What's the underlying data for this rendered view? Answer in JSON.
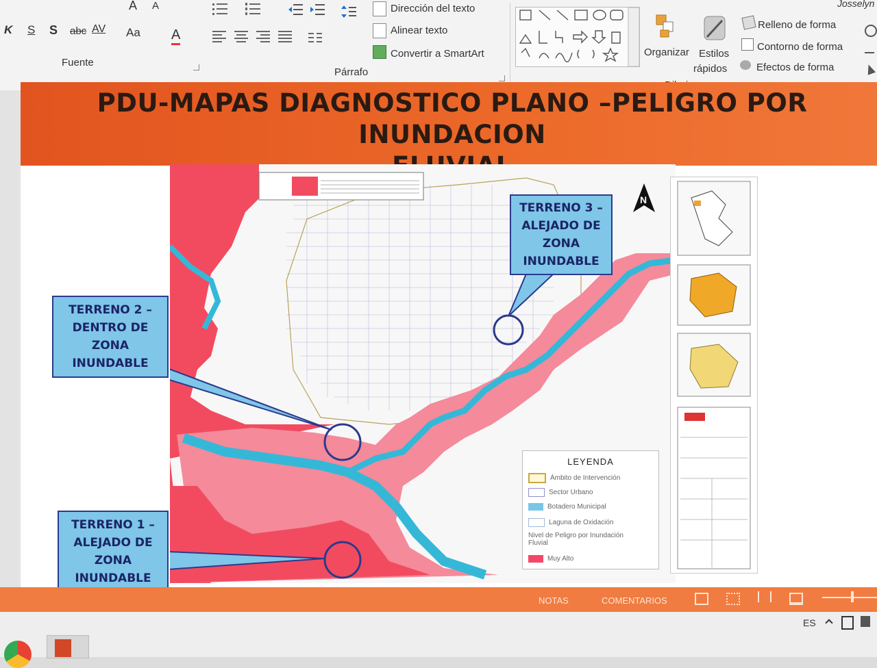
{
  "ribbon": {
    "font_group": {
      "label": "Fuente",
      "bold": "K",
      "underline": "S",
      "shadow": "S",
      "strike": "abc",
      "spacing": "AV",
      "case": "Aa",
      "color": "A",
      "grow": "A",
      "shrink": "A"
    },
    "paragraph_group": {
      "label": "Párrafo",
      "text_direction": "Dirección del texto",
      "align_text": "Alinear texto",
      "smartart": "Convertir a SmartArt"
    },
    "drawing_group": {
      "label": "Dibujo",
      "arrange": "Organizar",
      "quick_styles_1": "Estilos",
      "quick_styles_2": "rápidos",
      "shape_fill": "Relleno de forma",
      "shape_outline": "Contorno de forma",
      "shape_effects": "Efectos de forma"
    },
    "user": "Josselyn"
  },
  "slide": {
    "title_line1": "PDU-MAPAS DIAGNOSTICO PLANO –PELIGRO POR INUNDACION",
    "title_line2": "FLUVIAL",
    "callouts": {
      "terreno3": [
        "TERRENO 3 –",
        "ALEJADO DE",
        "ZONA",
        "INUNDABLE"
      ],
      "terreno2": [
        "TERRENO 2 –",
        "DENTRO DE",
        "ZONA",
        "INUNDABLE"
      ],
      "terreno1": [
        "TERRENO 1 –",
        "ALEJADO DE",
        "ZONA",
        "INUNDABLE"
      ]
    },
    "legend": {
      "title": "LEYENDA",
      "items": [
        "Ámbito de Intervención",
        "Sector Urbano",
        "Botadero Municipal",
        "Laguna de Oxidación"
      ],
      "level_title_1": "Nivel de Peligro por Inundación",
      "level_title_2": "Fluvial",
      "level_item": "Muy Alto",
      "colors": {
        "muy_alto": "#f3486a",
        "ambito": "#c8a93c",
        "sector": "#8f8fd0",
        "botadero": "#79c6e6",
        "laguna": "#b8d8ef"
      }
    },
    "north": "N"
  },
  "statusbar": {
    "notes": "NOTAS",
    "comments": "COMENTARIOS"
  },
  "taskbar": {
    "language": "ES"
  },
  "colors": {
    "flood_red": "#f24b60",
    "flood_pink": "#f48a9a",
    "river": "#35b8d8",
    "title_band": "#e6571f",
    "callout_fill": "#7fc6e8",
    "callout_border": "#2b3a8c"
  }
}
